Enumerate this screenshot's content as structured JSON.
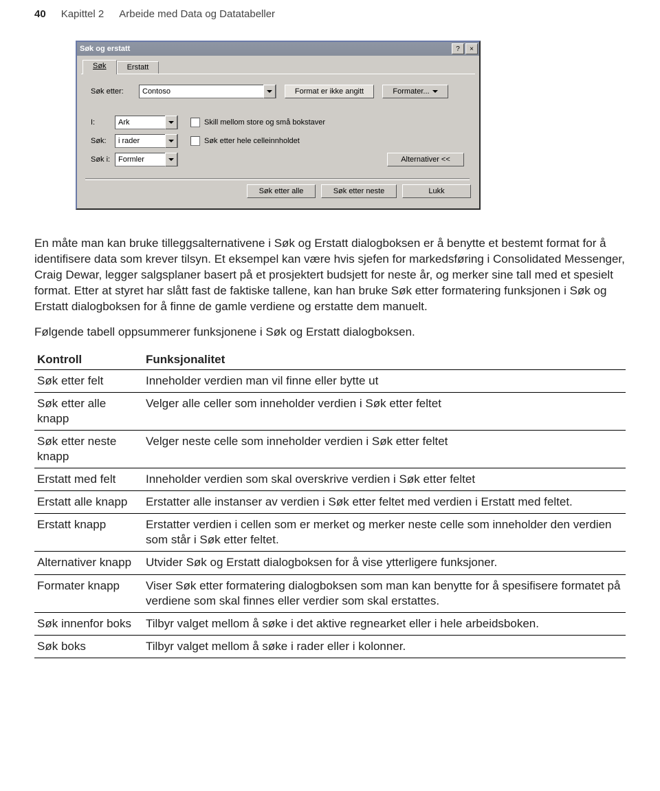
{
  "header": {
    "page_number": "40",
    "chapter_ref": "Kapittel 2",
    "chapter_title": "Arbeide med Data og Datatabeller"
  },
  "dialog": {
    "title": "Søk og erstatt",
    "help_char": "?",
    "close_char": "×",
    "tabs": {
      "sok": "Søk",
      "erstatt": "Erstatt"
    },
    "labels": {
      "sok_etter": "Søk etter:",
      "i": "I:",
      "sok": "Søk:",
      "sok_i": "Søk i:"
    },
    "values": {
      "sok_etter": "Contoso",
      "i": "Ark",
      "sok": "i rader",
      "sok_i": "Formler"
    },
    "format_msg": "Format er ikke angitt",
    "buttons": {
      "formater": "Formater...",
      "alternativer": "Alternativer <<",
      "sok_etter_alle": "Søk etter alle",
      "sok_etter_neste": "Søk etter neste",
      "lukk": "Lukk"
    },
    "checks": {
      "skill_case": "Skill mellom store og små bokstaver",
      "hele_celle": "Søk etter hele celleinnholdet"
    }
  },
  "paragraphs": {
    "p1": "En måte man kan bruke tilleggsalternativene i Søk og Erstatt dialogboksen er å benytte et bestemt format for å identifisere data som krever tilsyn. Et eksempel kan være hvis sjefen for markedsføring i Consolidated Messenger, Craig Dewar, legger salgsplaner basert på et prosjektert budsjett for neste år, og merker sine tall med et spesielt format. Etter at styret har slått fast de faktiske tallene, kan han bruke Søk etter formatering funksjonen i Søk og Erstatt dialogboksen for å finne de gamle verdiene og erstatte dem manuelt.",
    "p2": "Følgende tabell oppsummerer funksjonene i Søk og Erstatt dialogboksen."
  },
  "table": {
    "head_l": "Kontroll",
    "head_r": "Funksjonalitet",
    "rows": [
      {
        "l": "Søk etter felt",
        "r": "Inneholder verdien man vil finne eller bytte ut"
      },
      {
        "l": "Søk etter alle knapp",
        "r": "Velger alle celler som inneholder verdien i Søk etter feltet"
      },
      {
        "l": "Søk etter neste knapp",
        "r": "Velger neste celle som inneholder verdien i Søk etter feltet"
      },
      {
        "l": "Erstatt med felt",
        "r": "Inneholder verdien som skal overskrive verdien i Søk etter feltet"
      },
      {
        "l": "Erstatt alle knapp",
        "r": "Erstatter alle instanser av verdien i Søk etter feltet med verdien i Erstatt med feltet."
      },
      {
        "l": "Erstatt knapp",
        "r": "Erstatter verdien i cellen som er merket og merker neste celle som inneholder den verdien som står i Søk etter feltet."
      },
      {
        "l": "Alternativer knapp",
        "r": "Utvider Søk og Erstatt dialogboksen for å vise ytterligere funksjoner."
      },
      {
        "l": "Formater knapp",
        "r": "Viser Søk etter formatering dialogboksen som man kan benytte for å spesifisere formatet på verdiene som skal finnes eller verdier som skal erstattes."
      },
      {
        "l": "Søk innenfor boks",
        "r": "Tilbyr valget mellom å søke i det aktive regnearket eller i hele arbeidsboken."
      },
      {
        "l": "Søk boks",
        "r": "Tilbyr valget mellom å søke i rader eller i kolonner."
      }
    ]
  }
}
